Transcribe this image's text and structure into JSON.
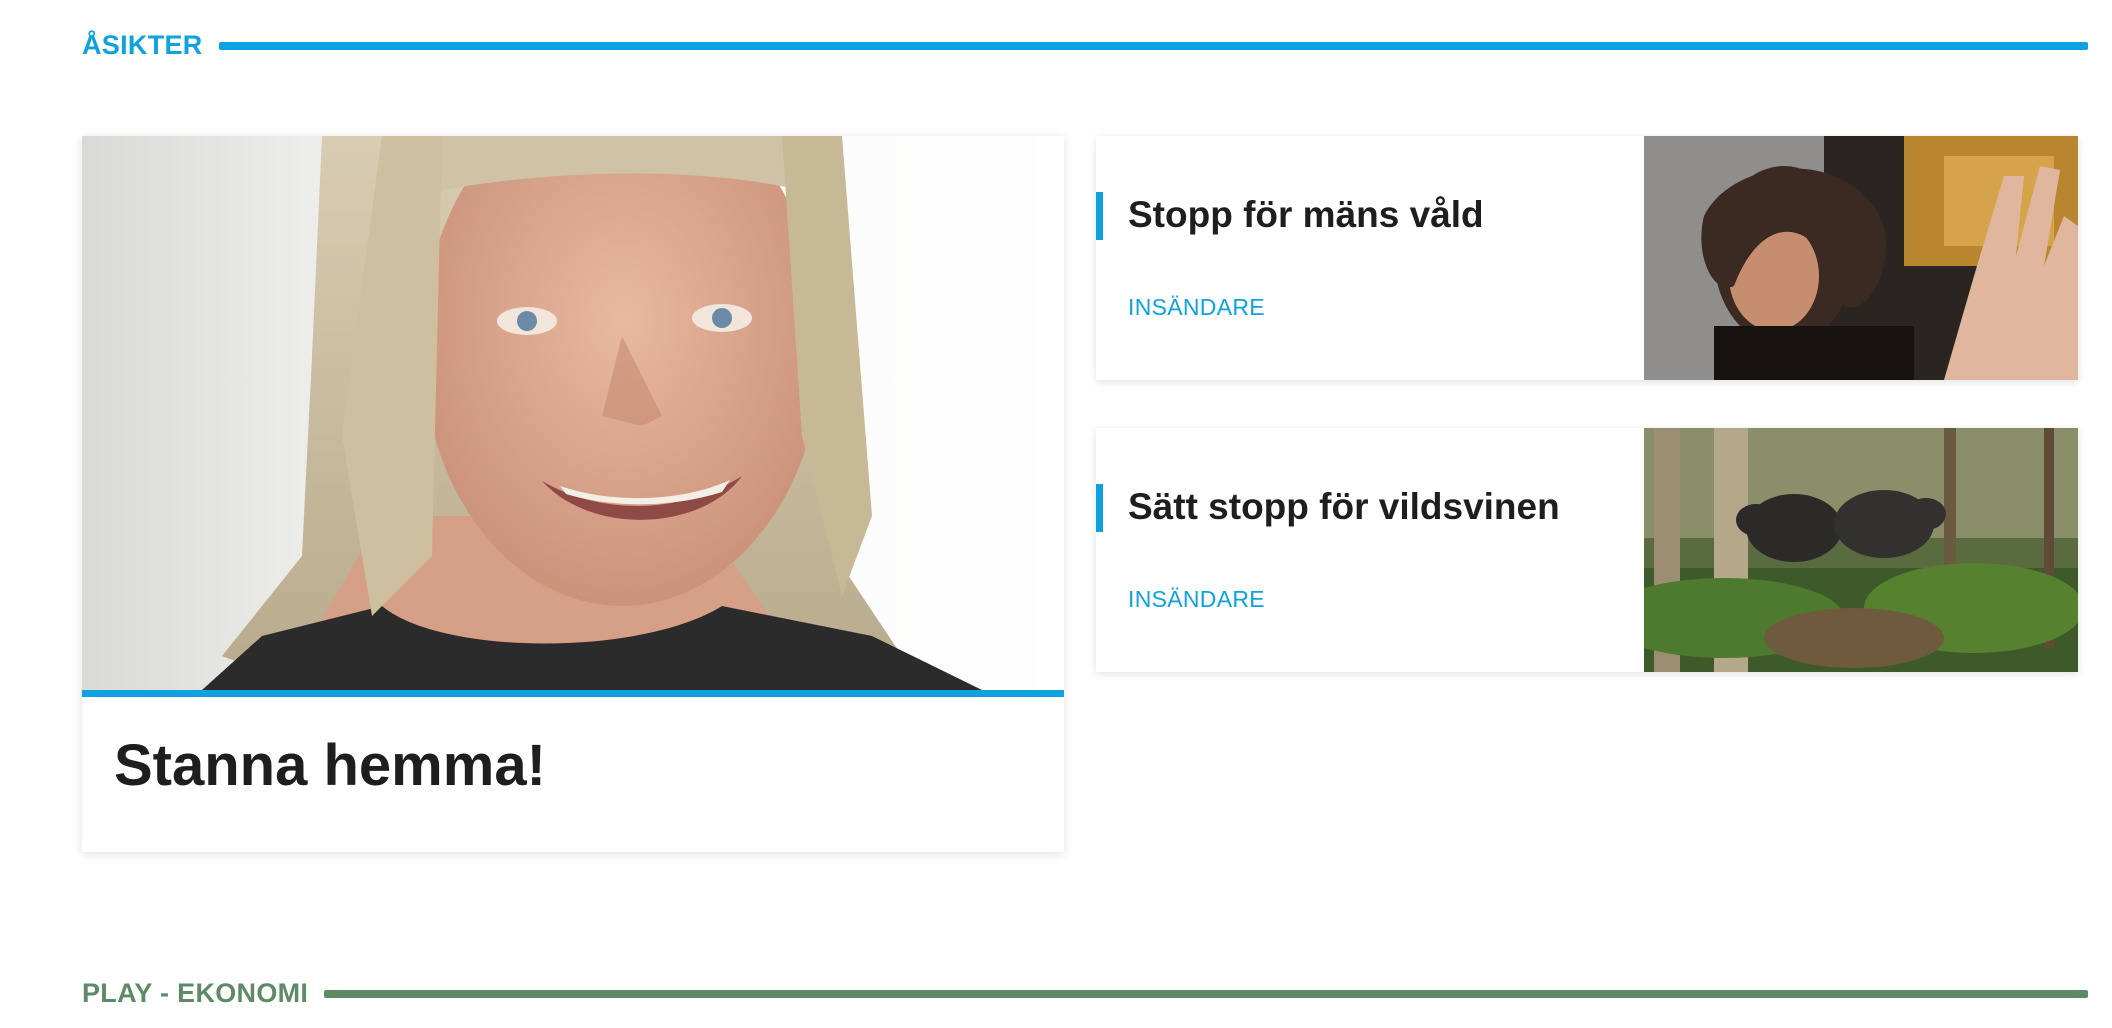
{
  "sections": {
    "asikter": {
      "label": "ÅSIKTER",
      "color": "#0ea2de"
    },
    "play_ekonomi": {
      "label": "PLAY - EKONOMI",
      "color": "#5e8a66"
    }
  },
  "featured": {
    "title": "Stanna hemma!",
    "image": "portrait-photo"
  },
  "articles": [
    {
      "title": "Stopp för mäns våld",
      "category": "INSÄNDARE",
      "image": "violence-photo"
    },
    {
      "title": "Sätt stopp för vildsvinen",
      "category": "INSÄNDARE",
      "image": "wild-boar-photo"
    }
  ],
  "accent_color": "#0ea2de"
}
